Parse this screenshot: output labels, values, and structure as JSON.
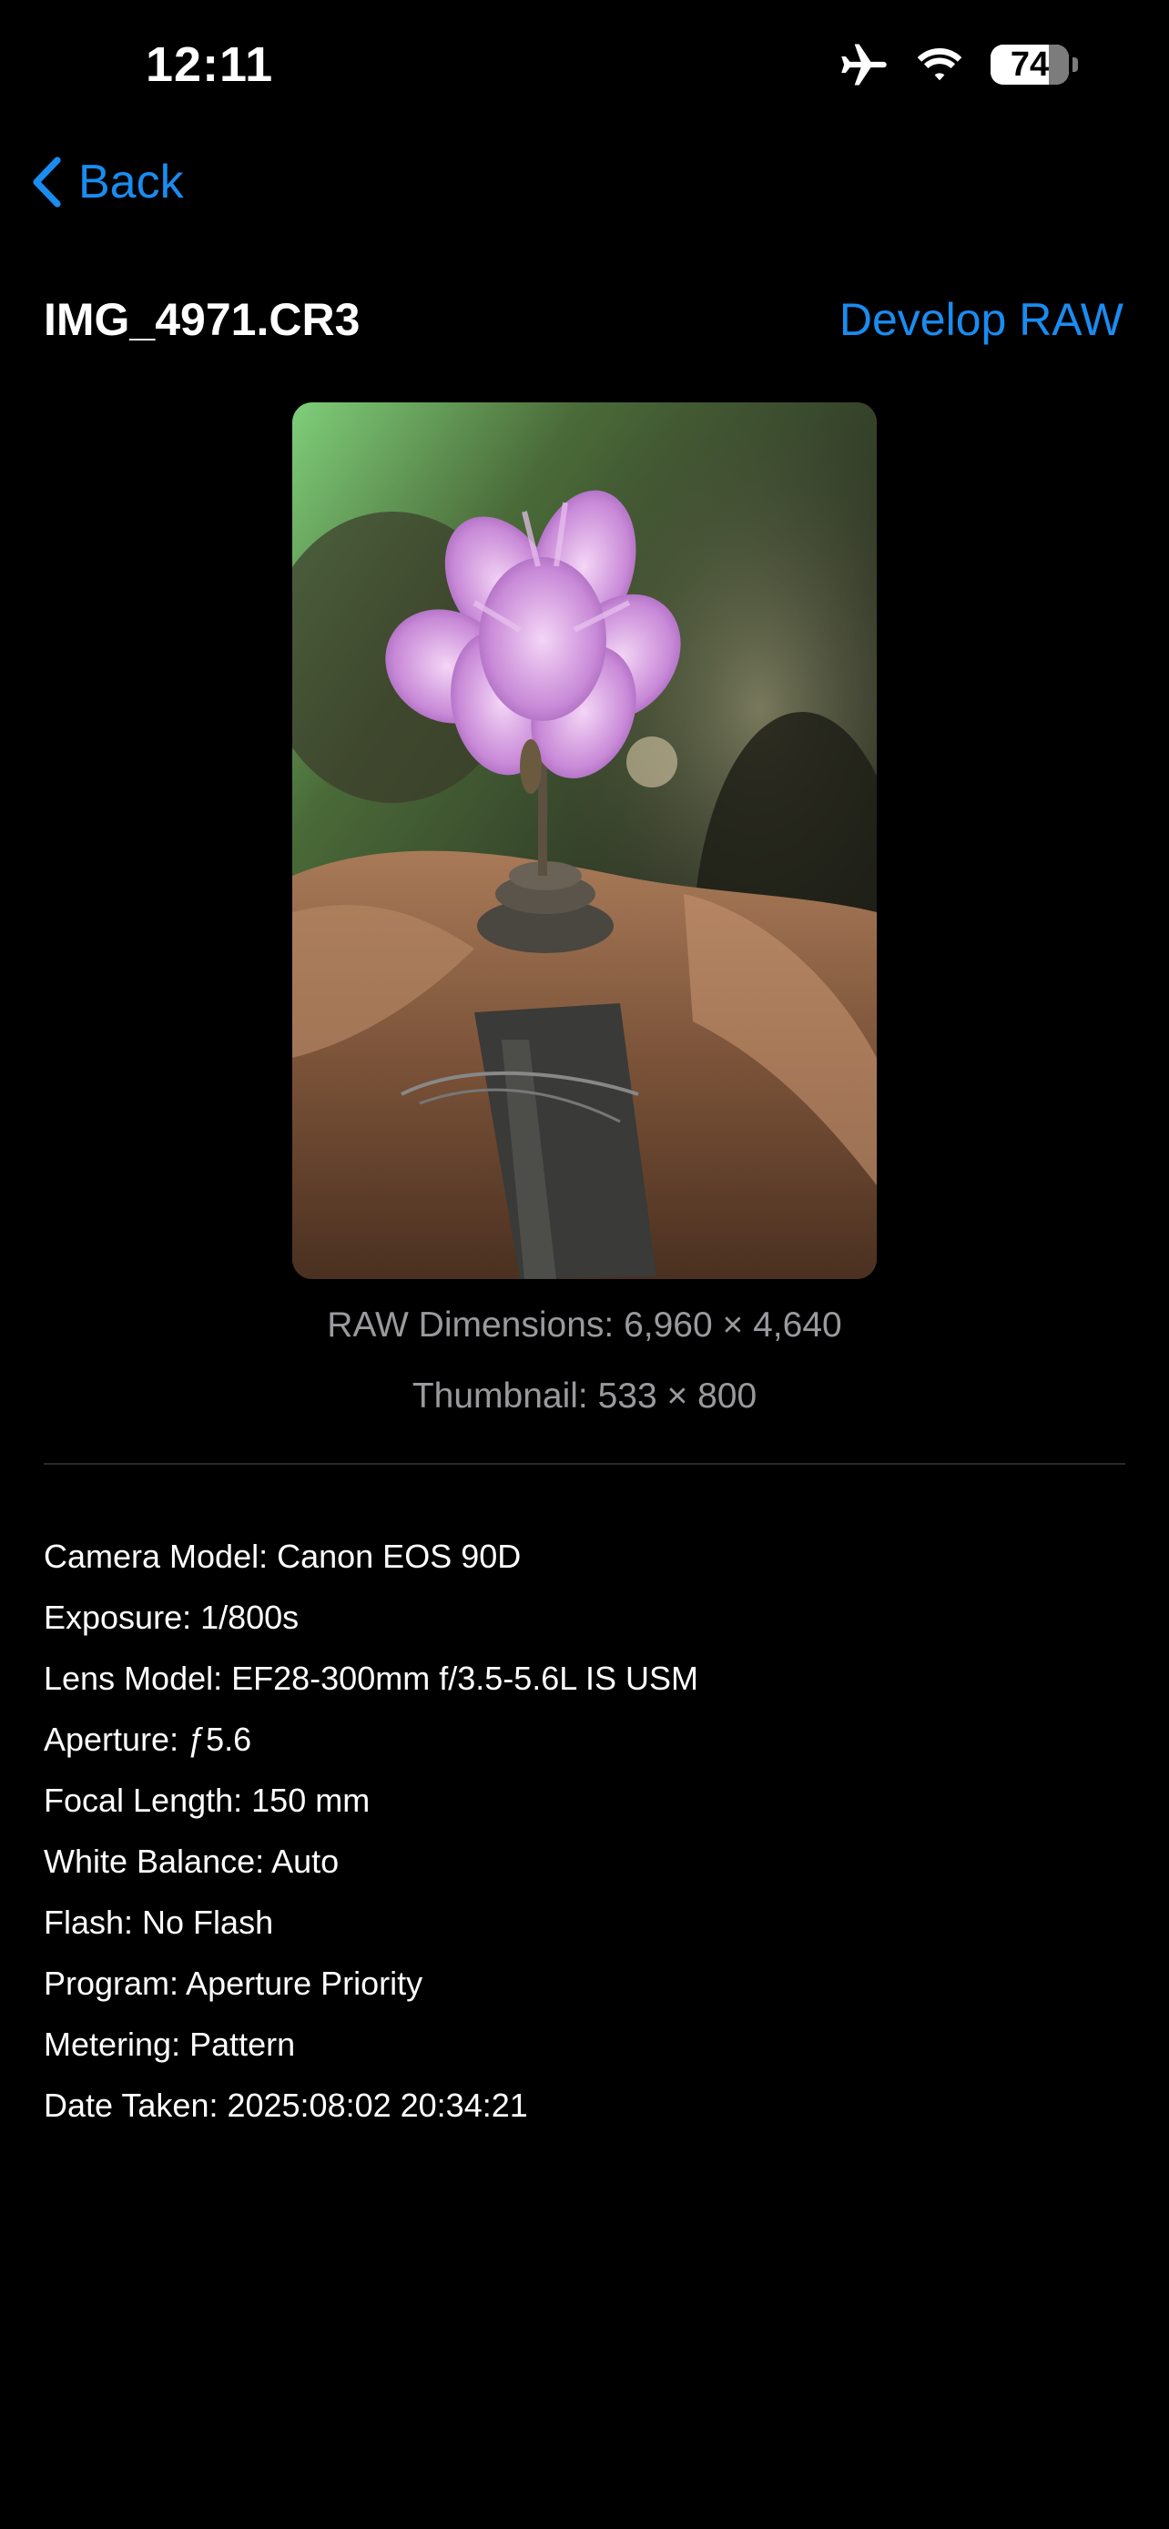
{
  "status_bar": {
    "time": "12:11",
    "battery_level": "74",
    "icons": [
      "airplane-icon",
      "wifi-icon",
      "battery-icon"
    ]
  },
  "nav": {
    "back_label": "Back"
  },
  "header": {
    "file_name": "IMG_4971.CR3",
    "develop_label": "Develop RAW"
  },
  "preview": {
    "raw_dimensions": "RAW Dimensions: 6,960 × 4,640",
    "thumbnail_size": "Thumbnail: 533 × 800"
  },
  "metadata": [
    "Camera Model: Canon EOS 90D",
    "Exposure: 1/800s",
    "Lens Model: EF28-300mm f/3.5-5.6L IS USM",
    "Aperture: ƒ5.6",
    "Focal Length: 150 mm",
    "White Balance: Auto",
    "Flash: No Flash",
    "Program: Aperture Priority",
    "Metering: Pattern",
    "Date Taken: 2025:08:02 20:34:21"
  ],
  "colors": {
    "accent": "#1a8cf0",
    "background": "#000000",
    "secondary_text": "#9a9a9e"
  }
}
